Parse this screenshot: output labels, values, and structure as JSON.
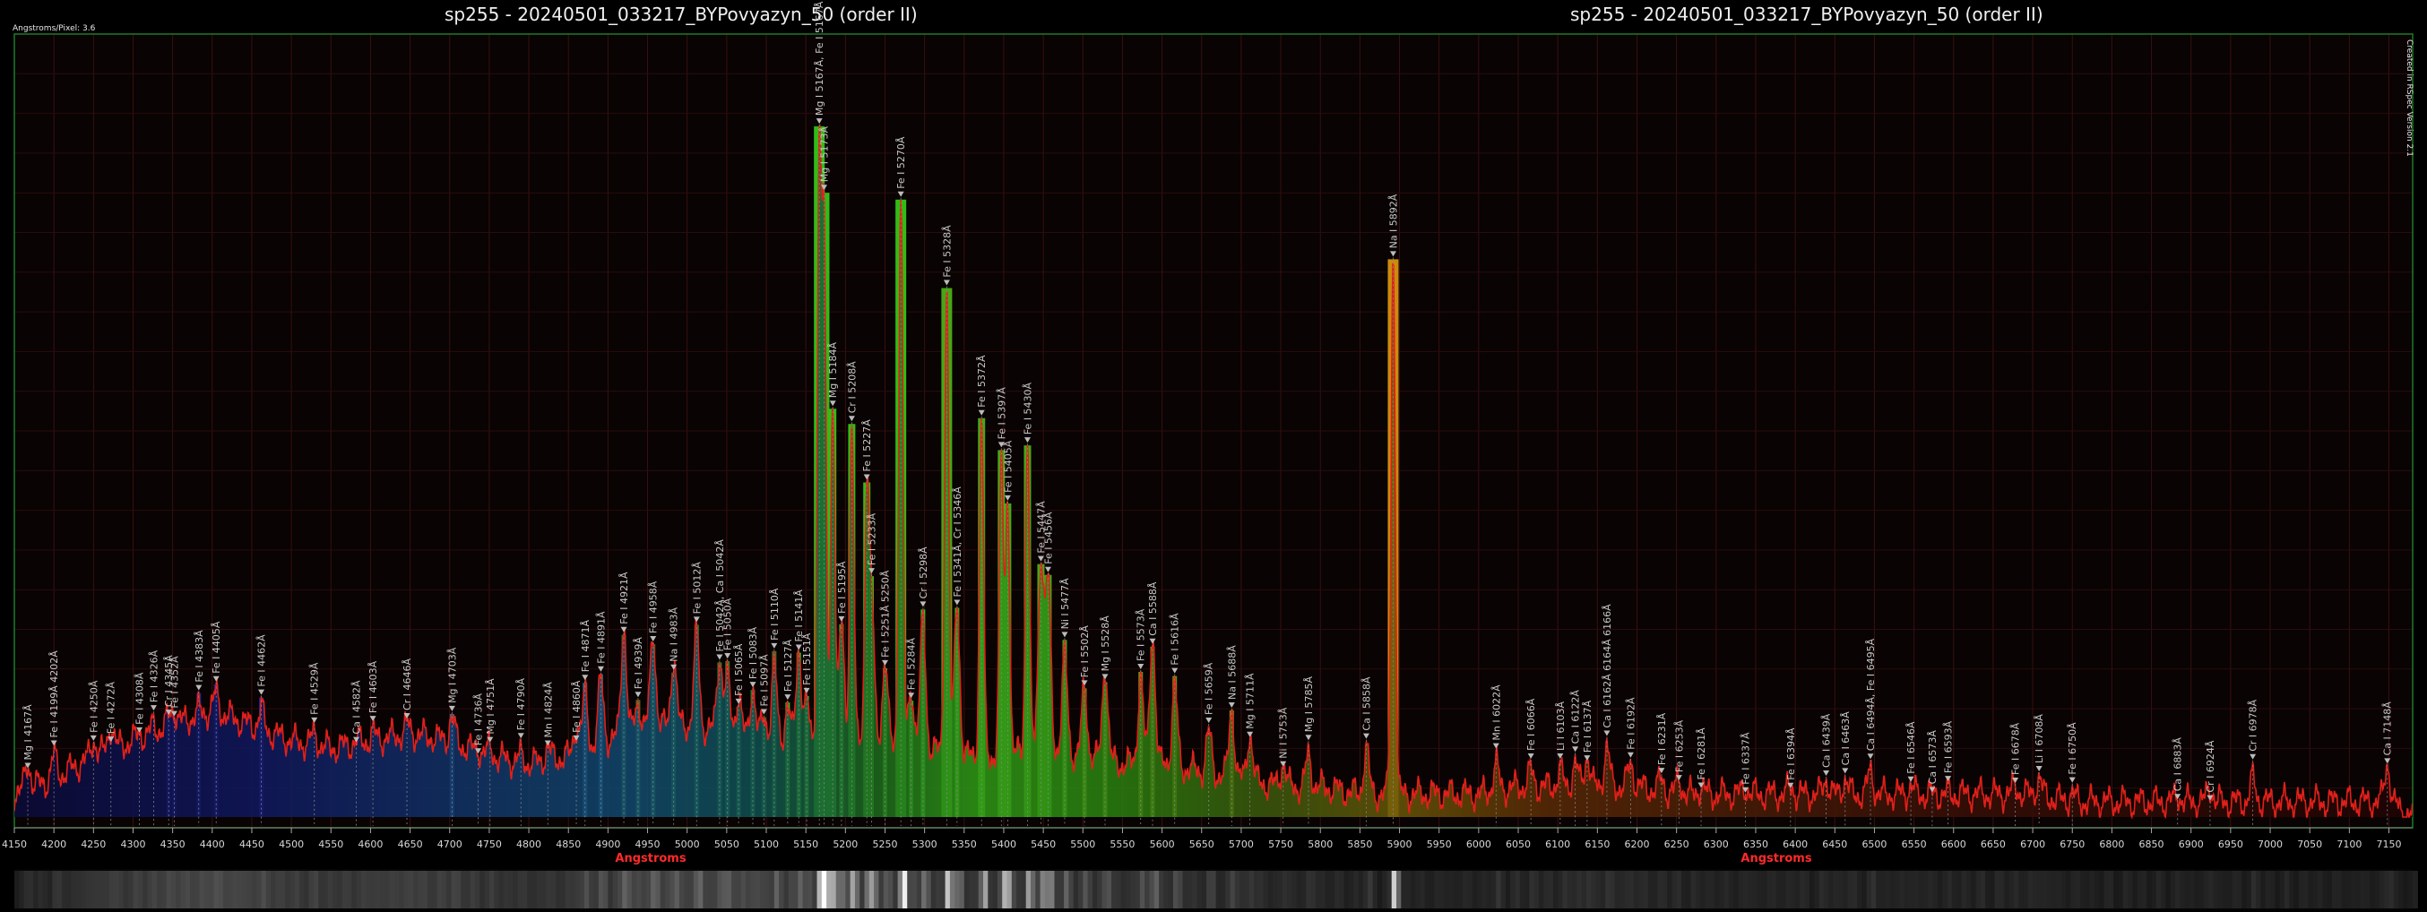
{
  "titles": [
    "sp255 - 20240501_033217_BYPovyazyn_50 (order II)",
    "sp255 - 20240501_033217_BYPovyazyn_50 (order II)"
  ],
  "angstroms_per_pixel_label": "Angstroms/Pixel: 3.6",
  "software_label": "Created in RSpec Version 2.1",
  "chart_data": {
    "type": "line",
    "xlabel": "Angstroms",
    "ylabel": "",
    "xlim": [
      4150,
      7180
    ],
    "ylim": [
      0,
      1.0
    ],
    "grid": true,
    "x_ticks": [
      4150,
      4200,
      4250,
      4300,
      4350,
      4400,
      4450,
      4500,
      4550,
      4600,
      4650,
      4700,
      4750,
      4800,
      4850,
      4900,
      4950,
      5000,
      5050,
      5100,
      5150,
      5200,
      5250,
      5300,
      5350,
      5400,
      5450,
      5500,
      5550,
      5600,
      5650,
      5700,
      5750,
      5800,
      5850,
      5900,
      5950,
      6000,
      6050,
      6100,
      6150,
      6200,
      6250,
      6300,
      6350,
      6400,
      6450,
      6500,
      6550,
      6600,
      6650,
      6700,
      6750,
      6800,
      6850,
      6900,
      6950,
      7000,
      7050,
      7100,
      7150
    ],
    "continuum": {
      "x": [
        4150,
        4200,
        4250,
        4300,
        4350,
        4400,
        4450,
        4500,
        4550,
        4600,
        4650,
        4700,
        4750,
        4800,
        4850,
        4900,
        4950,
        5000,
        5050,
        5100,
        5150,
        5200,
        5250,
        5300,
        5350,
        5400,
        5450,
        5500,
        5550,
        5600,
        5650,
        5700,
        5750,
        5800,
        5850,
        5900,
        5950,
        6000,
        6050,
        6100,
        6150,
        6200,
        6250,
        6300,
        6350,
        6400,
        6450,
        6500,
        6550,
        6600,
        6650,
        6700,
        6750,
        6800,
        6850,
        6900,
        6950,
        7000,
        7050,
        7100,
        7150,
        7180
      ],
      "y": [
        0.03,
        0.05,
        0.08,
        0.1,
        0.12,
        0.14,
        0.12,
        0.1,
        0.09,
        0.1,
        0.11,
        0.1,
        0.08,
        0.07,
        0.08,
        0.1,
        0.12,
        0.12,
        0.11,
        0.1,
        0.09,
        0.1,
        0.1,
        0.09,
        0.08,
        0.08,
        0.09,
        0.08,
        0.07,
        0.07,
        0.06,
        0.05,
        0.04,
        0.04,
        0.03,
        0.03,
        0.03,
        0.03,
        0.04,
        0.04,
        0.04,
        0.04,
        0.03,
        0.03,
        0.03,
        0.03,
        0.03,
        0.03,
        0.03,
        0.03,
        0.03,
        0.03,
        0.02,
        0.02,
        0.02,
        0.02,
        0.02,
        0.02,
        0.02,
        0.02,
        0.02,
        0.0
      ]
    },
    "peaks": [
      {
        "x": 4167,
        "y": 0.07,
        "label": "Mg I 4167Å"
      },
      {
        "x": 4200,
        "y": 0.08,
        "label": "Fe I 4199Å 4202Å"
      },
      {
        "x": 4250,
        "y": 0.1,
        "label": "Fe I 4250Å"
      },
      {
        "x": 4272,
        "y": 0.12,
        "label": "Fe I 4272Å"
      },
      {
        "x": 4308,
        "y": 0.11,
        "label": "Fe I 4308Å"
      },
      {
        "x": 4326,
        "y": 0.12,
        "label": "Fe I 4326Å"
      },
      {
        "x": 4345,
        "y": 0.13,
        "label": "Cr I 4345Å"
      },
      {
        "x": 4352,
        "y": 0.14,
        "label": "Fe I 4352Å"
      },
      {
        "x": 4383,
        "y": 0.14,
        "label": "Fe I 4383Å"
      },
      {
        "x": 4405,
        "y": 0.16,
        "label": "Fe I 4405Å"
      },
      {
        "x": 4462,
        "y": 0.14,
        "label": "Fe I 4462Å"
      },
      {
        "x": 4529,
        "y": 0.11,
        "label": "Fe I 4529Å"
      },
      {
        "x": 4582,
        "y": 0.1,
        "label": "Ca I 4582Å"
      },
      {
        "x": 4603,
        "y": 0.11,
        "label": "Fe I 4603Å"
      },
      {
        "x": 4646,
        "y": 0.12,
        "label": "Cr I 4646Å"
      },
      {
        "x": 4703,
        "y": 0.13,
        "label": "Mg I 4703Å"
      },
      {
        "x": 4736,
        "y": 0.09,
        "label": "Fe I 4736Å"
      },
      {
        "x": 4751,
        "y": 0.09,
        "label": "Mg I 4751Å"
      },
      {
        "x": 4790,
        "y": 0.08,
        "label": "Fe I 4790Å"
      },
      {
        "x": 4824,
        "y": 0.09,
        "label": "Mn I 4824Å"
      },
      {
        "x": 4860,
        "y": 0.12,
        "label": "Fe I 4860Å"
      },
      {
        "x": 4871,
        "y": 0.16,
        "label": "Fe I 4871Å"
      },
      {
        "x": 4891,
        "y": 0.18,
        "label": "Fe I 4891Å"
      },
      {
        "x": 4920,
        "y": 0.25,
        "label": "Fe I 4921Å"
      },
      {
        "x": 4938,
        "y": 0.15,
        "label": "Fe I 4939Å"
      },
      {
        "x": 4957,
        "y": 0.24,
        "label": "Fe I 4958Å"
      },
      {
        "x": 4983,
        "y": 0.21,
        "label": "Na I 4983Å"
      },
      {
        "x": 5012,
        "y": 0.24,
        "label": "Fe I 5012Å"
      },
      {
        "x": 5041,
        "y": 0.21,
        "label": "Fe I 5042Å, Ca I 5042Å"
      },
      {
        "x": 5051,
        "y": 0.18,
        "label": "Fe I 5050Å"
      },
      {
        "x": 5065,
        "y": 0.16,
        "label": "Fe I 5065Å"
      },
      {
        "x": 5083,
        "y": 0.17,
        "label": "Fe I 5083Å"
      },
      {
        "x": 5097,
        "y": 0.13,
        "label": "Fe I 5097Å"
      },
      {
        "x": 5110,
        "y": 0.2,
        "label": "Fe I 5110Å"
      },
      {
        "x": 5127,
        "y": 0.15,
        "label": "Fe I 5127Å"
      },
      {
        "x": 5141,
        "y": 0.22,
        "label": "Fe I 5141Å"
      },
      {
        "x": 5151,
        "y": 0.15,
        "label": "Fe I 5151Å"
      },
      {
        "x": 5167,
        "y": 0.86,
        "label": "Mg I 5167Å, Fe I 5167Å"
      },
      {
        "x": 5173,
        "y": 0.74,
        "label": "Mg I 5173Å"
      },
      {
        "x": 5184,
        "y": 0.55,
        "label": "Mg I 5184Å"
      },
      {
        "x": 5195,
        "y": 0.25,
        "label": "Fe I 5195Å"
      },
      {
        "x": 5208,
        "y": 0.52,
        "label": "Cr I 5208Å"
      },
      {
        "x": 5227,
        "y": 0.42,
        "label": "Fe I 5227Å"
      },
      {
        "x": 5233,
        "y": 0.28,
        "label": "Fe I 5233Å"
      },
      {
        "x": 5250,
        "y": 0.2,
        "label": "Fe I 5251Å 5250Å"
      },
      {
        "x": 5270,
        "y": 0.81,
        "label": "Fe I 5270Å"
      },
      {
        "x": 5283,
        "y": 0.17,
        "label": "Fe I 5284Å"
      },
      {
        "x": 5298,
        "y": 0.26,
        "label": "Cr I 5298Å"
      },
      {
        "x": 5328,
        "y": 0.69,
        "label": "Fe I 5328Å"
      },
      {
        "x": 5341,
        "y": 0.28,
        "label": "Fe I 5341Å, Cr I 5346Å"
      },
      {
        "x": 5372,
        "y": 0.52,
        "label": "Fe I 5372Å"
      },
      {
        "x": 5397,
        "y": 0.47,
        "label": "Fe I 5397Å"
      },
      {
        "x": 5405,
        "y": 0.42,
        "label": "Fe I 5405Å"
      },
      {
        "x": 5430,
        "y": 0.5,
        "label": "Fe I 5430Å"
      },
      {
        "x": 5447,
        "y": 0.34,
        "label": "Fe I 5447Å"
      },
      {
        "x": 5456,
        "y": 0.31,
        "label": "Fe I 5456Å"
      },
      {
        "x": 5477,
        "y": 0.21,
        "label": "Ni I 5477Å"
      },
      {
        "x": 5502,
        "y": 0.17,
        "label": "Fe I 5502Å"
      },
      {
        "x": 5528,
        "y": 0.2,
        "label": "Mg I 5528Å"
      },
      {
        "x": 5573,
        "y": 0.18,
        "label": "Fe I 5573Å"
      },
      {
        "x": 5588,
        "y": 0.24,
        "label": "Ca I 5588Å"
      },
      {
        "x": 5616,
        "y": 0.17,
        "label": "Fe I 5616Å"
      },
      {
        "x": 5659,
        "y": 0.11,
        "label": "Fe I 5659Å"
      },
      {
        "x": 5688,
        "y": 0.14,
        "label": "Na I 5688Å"
      },
      {
        "x": 5711,
        "y": 0.11,
        "label": "Mg I 5711Å"
      },
      {
        "x": 5753,
        "y": 0.07,
        "label": "Ni I 5753Å"
      },
      {
        "x": 5785,
        "y": 0.08,
        "label": "Mg I 5785Å"
      },
      {
        "x": 5858,
        "y": 0.09,
        "label": "Ca I 5858Å"
      },
      {
        "x": 5892,
        "y": 0.74,
        "label": "Na I 5892Å"
      },
      {
        "x": 6022,
        "y": 0.07,
        "label": "Mn I 6022Å"
      },
      {
        "x": 6066,
        "y": 0.06,
        "label": "Fe I 6066Å"
      },
      {
        "x": 6103,
        "y": 0.06,
        "label": "Li I 6103Å"
      },
      {
        "x": 6122,
        "y": 0.07,
        "label": "Ca I 6122Å"
      },
      {
        "x": 6137,
        "y": 0.08,
        "label": "Fe I 6137Å"
      },
      {
        "x": 6162,
        "y": 0.09,
        "label": "Ca I 6162Å 6164Å 6166Å"
      },
      {
        "x": 6192,
        "y": 0.07,
        "label": "Fe I 6192Å"
      },
      {
        "x": 6231,
        "y": 0.05,
        "label": "Fe I 6231Å"
      },
      {
        "x": 6253,
        "y": 0.05,
        "label": "Fe I 6253Å"
      },
      {
        "x": 6281,
        "y": 0.04,
        "label": "Fe I 6281Å"
      },
      {
        "x": 6337,
        "y": 0.04,
        "label": "Fe I 6337Å"
      },
      {
        "x": 6394,
        "y": 0.04,
        "label": "Fe I 6394Å"
      },
      {
        "x": 6439,
        "y": 0.05,
        "label": "Ca I 6439Å"
      },
      {
        "x": 6463,
        "y": 0.05,
        "label": "Ca I 6463Å"
      },
      {
        "x": 6495,
        "y": 0.06,
        "label": "Ca I 6494Å, Fe I 6495Å"
      },
      {
        "x": 6546,
        "y": 0.04,
        "label": "Fe I 6546Å"
      },
      {
        "x": 6573,
        "y": 0.03,
        "label": "Ca I 6573Å"
      },
      {
        "x": 6593,
        "y": 0.03,
        "label": "Fe I 6593Å"
      },
      {
        "x": 6678,
        "y": 0.04,
        "label": "Fe I 6678Å"
      },
      {
        "x": 6708,
        "y": 0.05,
        "label": "Li I 6708Å"
      },
      {
        "x": 6750,
        "y": 0.03,
        "label": "Fe I 6750Å"
      },
      {
        "x": 6883,
        "y": 0.03,
        "label": "Ca I 6883Å"
      },
      {
        "x": 6924,
        "y": 0.04,
        "label": "Cr I 6924Å"
      },
      {
        "x": 6978,
        "y": 0.05,
        "label": "Cr I 6978Å"
      },
      {
        "x": 7148,
        "y": 0.07,
        "label": "Ca I 7148Å"
      }
    ]
  }
}
